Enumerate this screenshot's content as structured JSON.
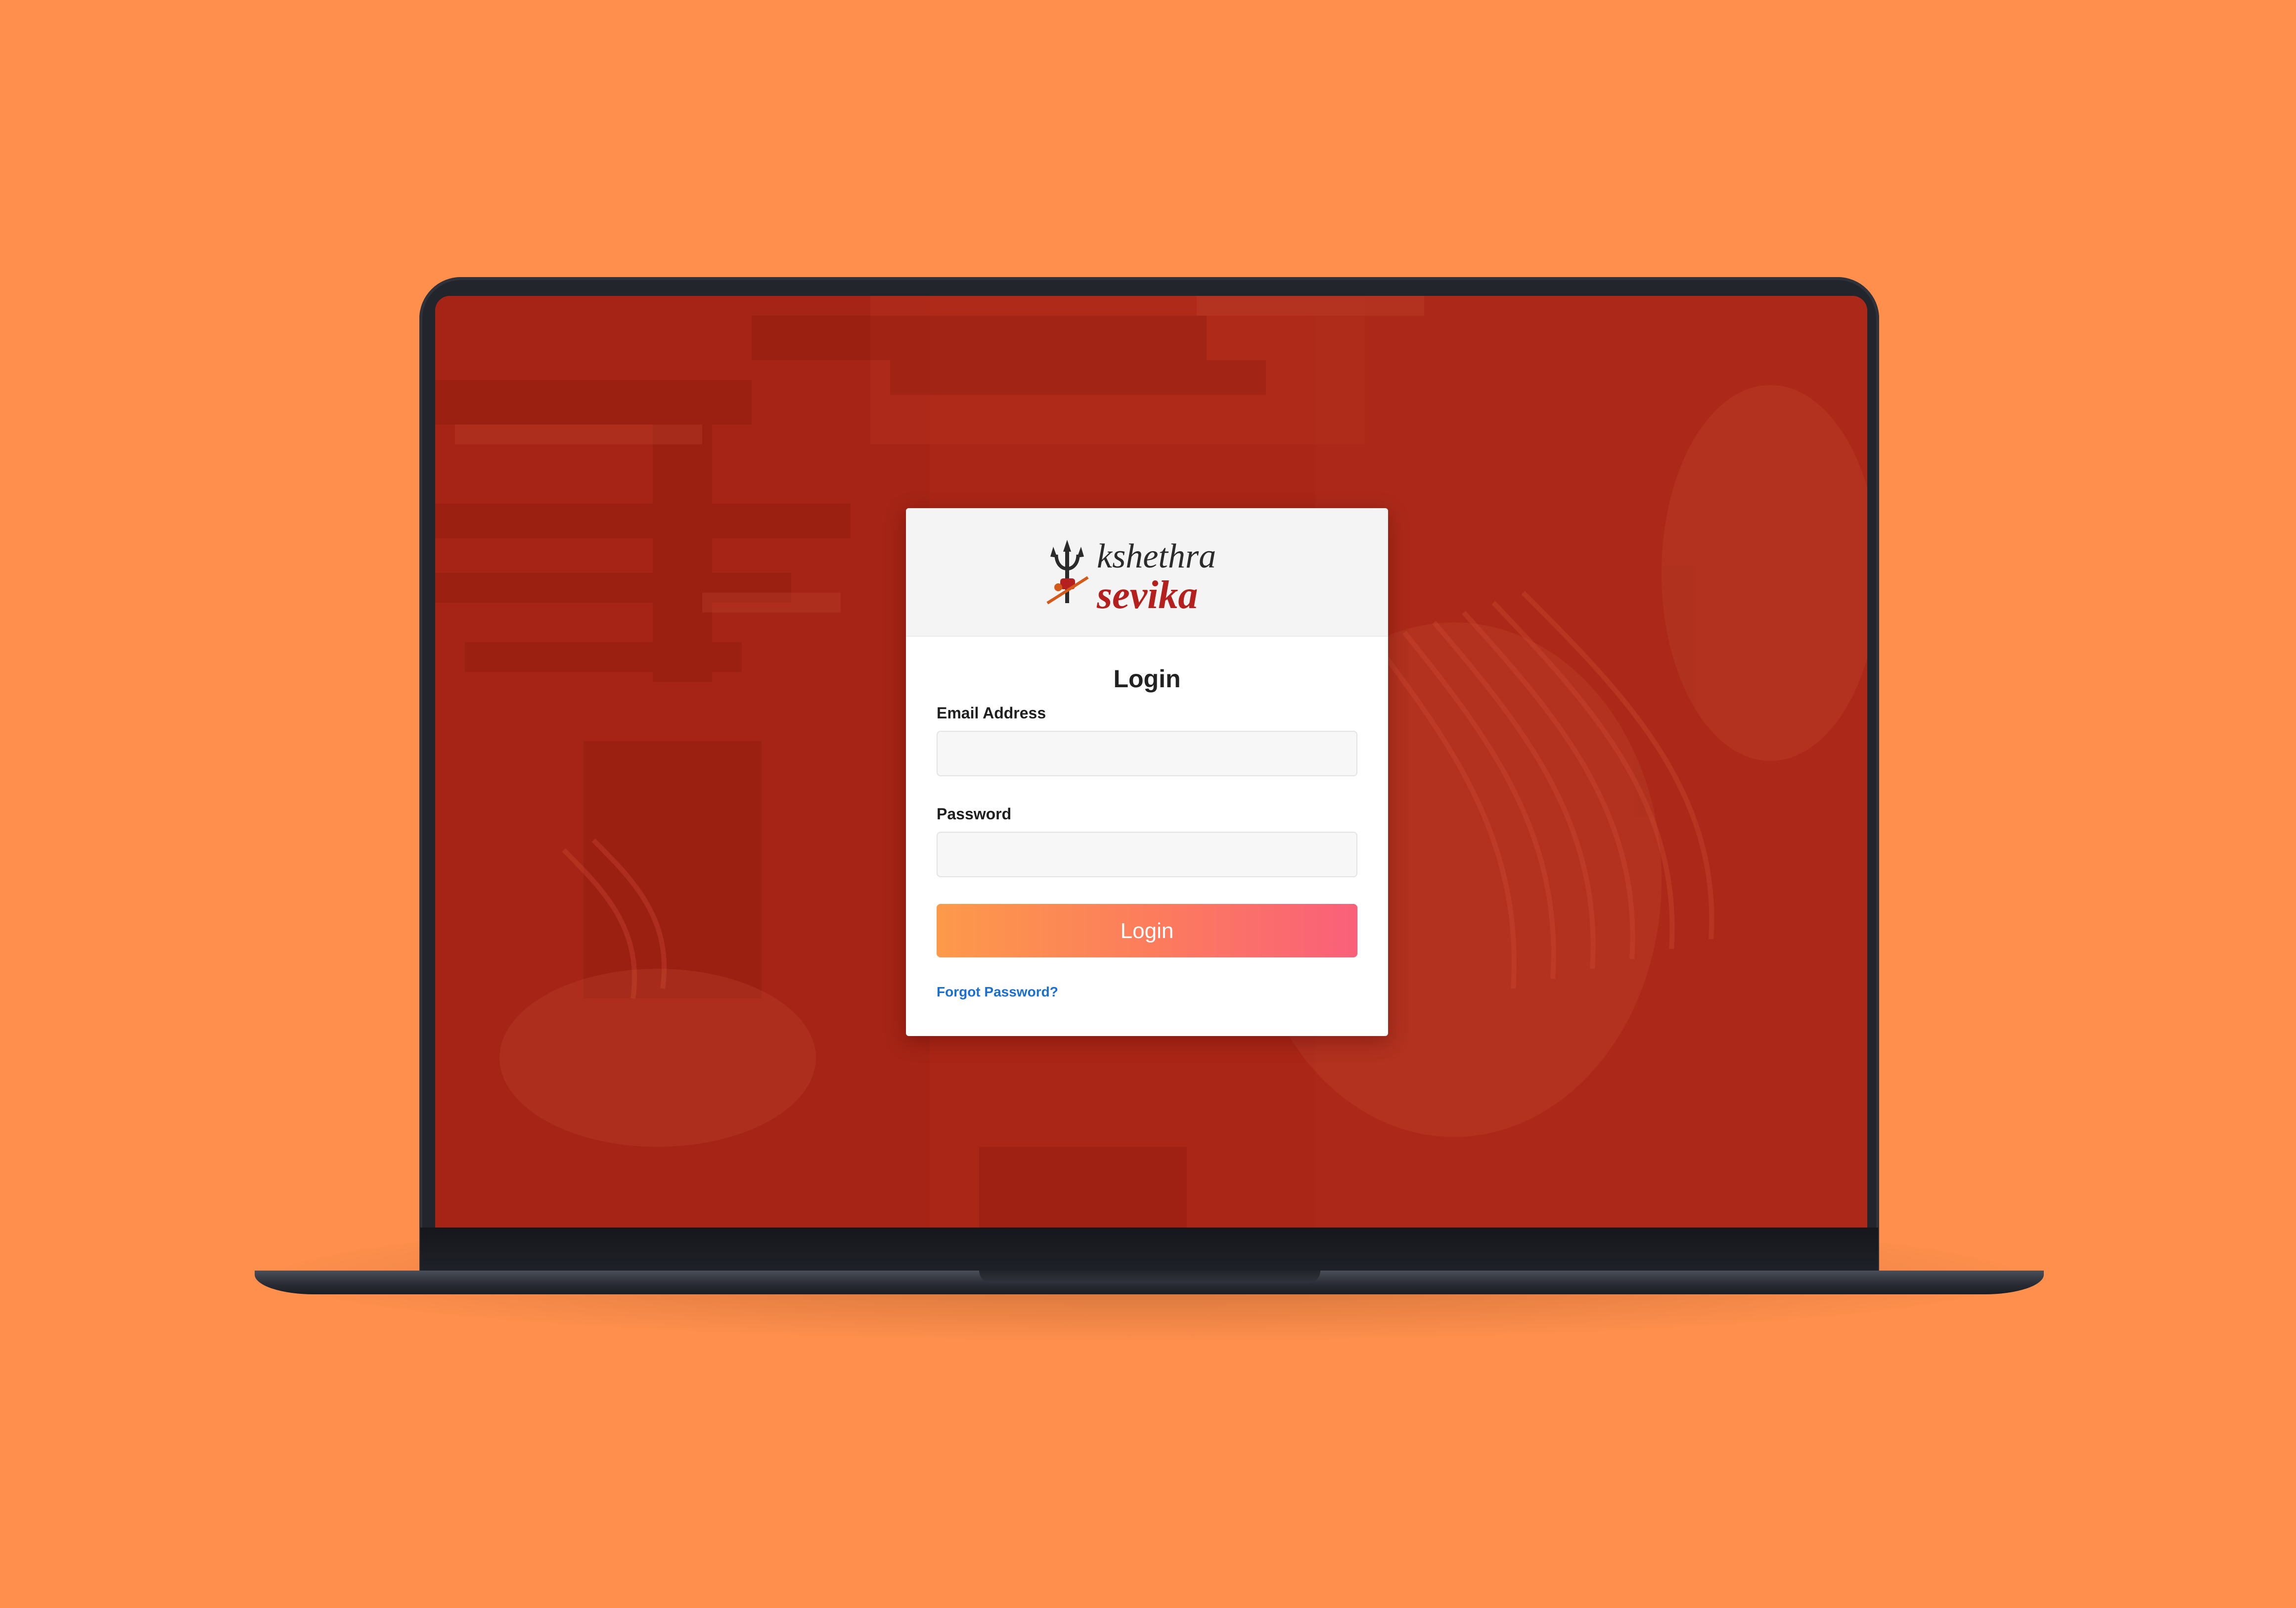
{
  "colors": {
    "page_background": "#fe8f4d",
    "screen_background": "#ac2918",
    "card_header": "#f4f4f4",
    "button_gradient_start": "#fd9a4a",
    "button_gradient_end": "#f9607a",
    "link": "#1a6fd1",
    "logo_dark": "#2b2b2b",
    "logo_red": "#b3201e"
  },
  "logo": {
    "line1": "kshethra",
    "line2": "sevika",
    "icon": "trishul-icon"
  },
  "login": {
    "title": "Login",
    "email_label": "Email Address",
    "email_value": "",
    "email_placeholder": "",
    "password_label": "Password",
    "password_value": "",
    "password_placeholder": "",
    "button_label": "Login",
    "forgot_link": "Forgot Password?"
  }
}
